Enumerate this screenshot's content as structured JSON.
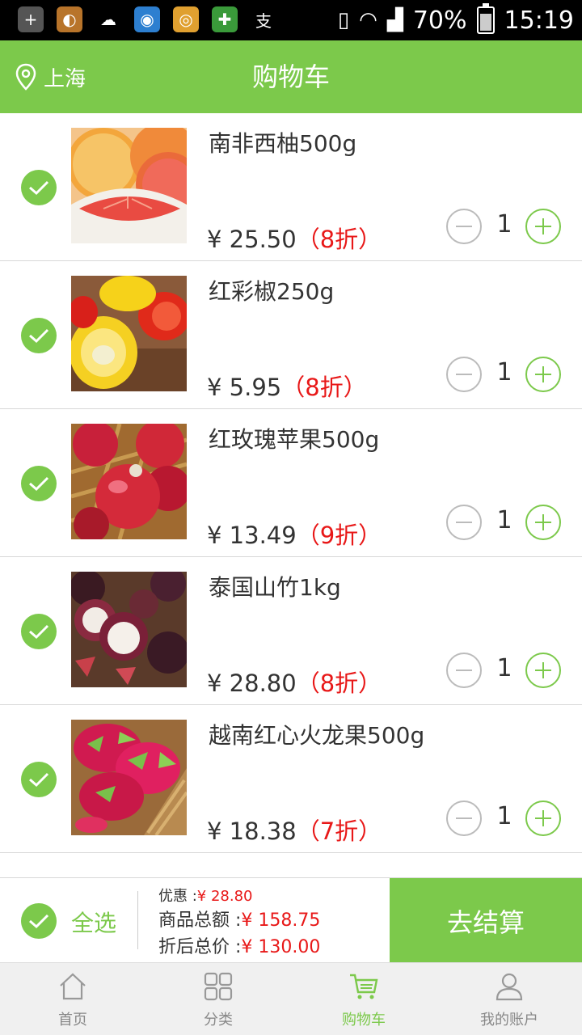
{
  "status_bar": {
    "battery": "70%",
    "time": "15:19"
  },
  "header": {
    "location": "上海",
    "title": "购物车"
  },
  "items": [
    {
      "name": "南非西柚500g",
      "price": "¥ 25.50",
      "discount": "（8折）",
      "qty": "1"
    },
    {
      "name": "红彩椒250g",
      "price": "¥ 5.95",
      "discount": "（8折）",
      "qty": "1"
    },
    {
      "name": "红玫瑰苹果500g",
      "price": "¥ 13.49",
      "discount": "（9折）",
      "qty": "1"
    },
    {
      "name": "泰国山竹1kg",
      "price": "¥ 28.80",
      "discount": "（8折）",
      "qty": "1"
    },
    {
      "name": "越南红心火龙果500g",
      "price": "¥ 18.38",
      "discount": "（7折）",
      "qty": "1"
    }
  ],
  "summary": {
    "select_all": "全选",
    "discount_label": "优惠 :",
    "discount_value": "¥ 28.80",
    "total_label": "商品总额 :",
    "total_value": "¥ 158.75",
    "final_label": "折后总价 :",
    "final_value": "¥ 130.00",
    "checkout": "去结算"
  },
  "tabs": [
    {
      "label": "首页",
      "icon": "home-icon",
      "active": false
    },
    {
      "label": "分类",
      "icon": "grid-icon",
      "active": false
    },
    {
      "label": "购物车",
      "icon": "cart-icon",
      "active": true
    },
    {
      "label": "我的账户",
      "icon": "user-icon",
      "active": false
    }
  ],
  "colors": {
    "accent": "#7cc94b",
    "discount": "#e81818"
  }
}
